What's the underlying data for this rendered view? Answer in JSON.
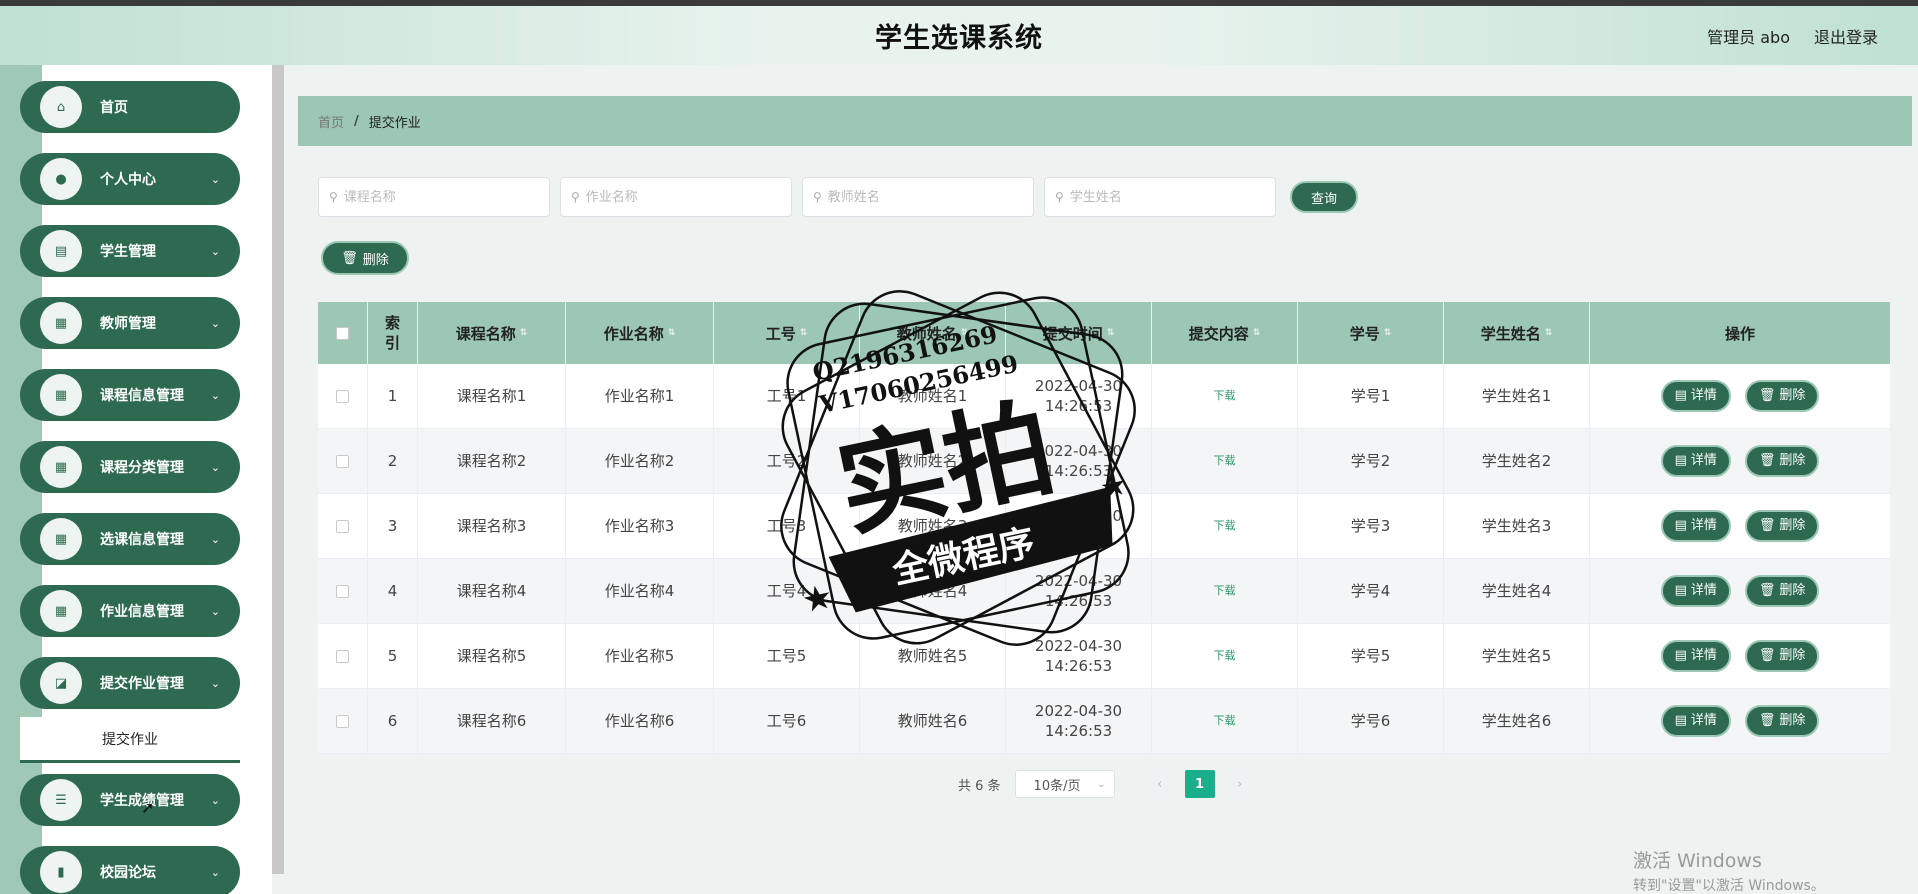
{
  "header": {
    "title": "学生选课系统",
    "user": "管理员 abo",
    "logout": "退出登录"
  },
  "sidebar": {
    "items": [
      {
        "label": "首页",
        "icon": "home-icon",
        "glyph": "⌂",
        "chevron": false
      },
      {
        "label": "个人中心",
        "icon": "user-icon",
        "glyph": "●",
        "chevron": true
      },
      {
        "label": "学生管理",
        "icon": "clipboard-icon",
        "glyph": "▤",
        "chevron": true
      },
      {
        "label": "教师管理",
        "icon": "grid-icon",
        "glyph": "▦",
        "chevron": true
      },
      {
        "label": "课程信息管理",
        "icon": "grid-icon",
        "glyph": "▦",
        "chevron": true
      },
      {
        "label": "课程分类管理",
        "icon": "grid-icon",
        "glyph": "▦",
        "chevron": true
      },
      {
        "label": "选课信息管理",
        "icon": "grid-icon",
        "glyph": "▦",
        "chevron": true
      },
      {
        "label": "作业信息管理",
        "icon": "grid-icon",
        "glyph": "▦",
        "chevron": true
      },
      {
        "label": "提交作业管理",
        "icon": "chart-icon",
        "glyph": "◪",
        "chevron": true
      },
      {
        "label": "学生成绩管理",
        "icon": "list-icon",
        "glyph": "☰",
        "chevron": true
      },
      {
        "label": "校园论坛",
        "icon": "bar-chart-icon",
        "glyph": "▮",
        "chevron": true
      }
    ],
    "submenu": "提交作业"
  },
  "breadcrumb": {
    "home": "首页",
    "separator": "/",
    "current": "提交作业"
  },
  "search": {
    "course_placeholder": "课程名称",
    "homework_placeholder": "作业名称",
    "teacher_placeholder": "教师姓名",
    "student_placeholder": "学生姓名",
    "query_label": "查询"
  },
  "actions": {
    "delete_label": "删除"
  },
  "table": {
    "headers": [
      "索\n引",
      "课程名称",
      "作业名称",
      "工号",
      "教师姓名",
      "提交时间",
      "提交内容",
      "学号",
      "学生姓名",
      "操作"
    ],
    "rows": [
      {
        "index": "1",
        "course": "课程名称1",
        "homework": "作业名称1",
        "job_no": "工号1",
        "teacher": "教师姓名1",
        "time": "2022-04-30 14:26:53",
        "content": "下载",
        "student_no": "学号1",
        "student": "学生姓名1"
      },
      {
        "index": "2",
        "course": "课程名称2",
        "homework": "作业名称2",
        "job_no": "工号2",
        "teacher": "教师姓名2",
        "time": "2022-04-30 14:26:53",
        "content": "下载",
        "student_no": "学号2",
        "student": "学生姓名2"
      },
      {
        "index": "3",
        "course": "课程名称3",
        "homework": "作业名称3",
        "job_no": "工号3",
        "teacher": "教师姓名3",
        "time": "2022-04-30 14:26:53",
        "content": "下载",
        "student_no": "学号3",
        "student": "学生姓名3"
      },
      {
        "index": "4",
        "course": "课程名称4",
        "homework": "作业名称4",
        "job_no": "工号4",
        "teacher": "教师姓名4",
        "time": "2022-04-30 14:26:53",
        "content": "下载",
        "student_no": "学号4",
        "student": "学生姓名4"
      },
      {
        "index": "5",
        "course": "课程名称5",
        "homework": "作业名称5",
        "job_no": "工号5",
        "teacher": "教师姓名5",
        "time": "2022-04-30 14:26:53",
        "content": "下载",
        "student_no": "学号5",
        "student": "学生姓名5"
      },
      {
        "index": "6",
        "course": "课程名称6",
        "homework": "作业名称6",
        "job_no": "工号6",
        "teacher": "教师姓名6",
        "time": "2022-04-30 14:26:53",
        "content": "下载",
        "student_no": "学号6",
        "student": "学生姓名6"
      }
    ],
    "detail_label": "详情",
    "delete_label": "删除"
  },
  "pagination": {
    "total": "共 6 条",
    "page_size": "10条/页",
    "current_page": "1"
  },
  "watermark": {
    "line1": "Q2196316269",
    "line2": "V17060256499",
    "big": "实拍",
    "banner": "全微程序"
  },
  "windows_activation": {
    "line1": "激活 Windows",
    "line2": "转到\"设置\"以激活 Windows。"
  },
  "colors": {
    "primary": "#2d6a50",
    "accent": "#9bc7b4",
    "pager_active": "#1aae8a"
  }
}
